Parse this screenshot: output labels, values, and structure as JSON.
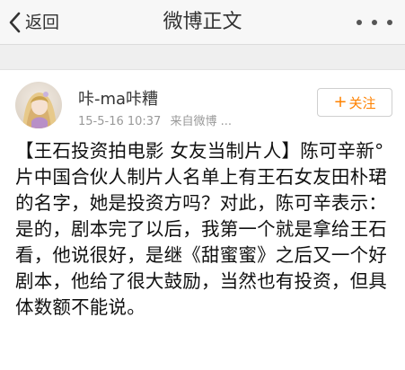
{
  "navbar": {
    "back_label": "返回",
    "title": "微博正文",
    "back_icon": "chevron-left-icon",
    "more_icon": "more-dots-icon"
  },
  "post": {
    "user": {
      "name": "咔-ma咔糟",
      "avatar_icon": "avatar"
    },
    "meta": {
      "time": "15-5-16 10:37",
      "source": "来自微博 ..."
    },
    "follow": {
      "plus": "+",
      "label": "关注"
    },
    "text": "【王石投资拍电影 女友当制片人】陈可辛新°片中国合伙人制片人名单上有王石女友田朴珺的名字，她是投资方吗？对此，陈可辛表示：是的，剧本完了以后，我第一个就是拿给王石看，他说很好，是继《甜蜜蜜》之后又一个好剧本，他给了很大鼓励，当然也有投资，但具体数额不能说。"
  },
  "colors": {
    "accent": "#ff8200",
    "navbar_bg": "#f7f7f7",
    "gap_bg": "#efefef"
  }
}
